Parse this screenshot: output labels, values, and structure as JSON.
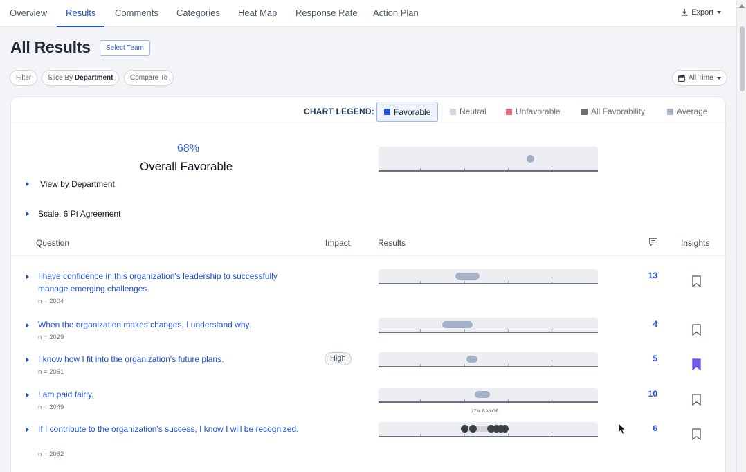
{
  "nav": {
    "tabs": [
      "Overview",
      "Results",
      "Comments",
      "Categories",
      "Heat Map",
      "Response Rate",
      "Action Plan"
    ],
    "active_tab": "Results",
    "export_label": "Export"
  },
  "header": {
    "title": "All Results",
    "select_team": "Select Team",
    "filter": "Filter",
    "slice_prefix": "Slice By",
    "slice_value": "Department",
    "compare": "Compare To",
    "time": "All Time"
  },
  "legend": {
    "title": "CHART LEGEND:",
    "items": [
      {
        "label": "Favorable",
        "color": "#1d4ed8",
        "active": true
      },
      {
        "label": "Neutral",
        "color": "#cfd6e2",
        "active": false
      },
      {
        "label": "Unfavorable",
        "color": "#e86a78",
        "active": false
      },
      {
        "label": "All Favorability",
        "color": "#6b6f76",
        "active": false
      },
      {
        "label": "Average",
        "color": "#a9b4c9",
        "active": false
      }
    ]
  },
  "overall": {
    "percent": "68%",
    "label": "Overall Favorable",
    "view_by": "View by Department",
    "scale": "Scale: 6 Pt Agreement",
    "marker_position": 0.69
  },
  "table": {
    "headers": {
      "question": "Question",
      "impact": "Impact",
      "results": "Results",
      "insights": "Insights"
    },
    "rows": [
      {
        "question": "I have confidence in this organization's leadership to successfully manage emerging challenges.",
        "n": "n = 2004",
        "impact": "",
        "count": "13",
        "bookmarked": false,
        "range_start": 0.35,
        "range_end": 0.46
      },
      {
        "question": "When the organization makes changes, I understand why.",
        "n": "n = 2029",
        "impact": "",
        "count": "4",
        "bookmarked": false,
        "range_start": 0.29,
        "range_end": 0.43
      },
      {
        "question": "I know how I fit into the organization's future plans.",
        "n": "n = 2051",
        "impact": "High",
        "count": "5",
        "bookmarked": true,
        "range_start": 0.4,
        "range_end": 0.45
      },
      {
        "question": "I am paid fairly.",
        "n": "n = 2049",
        "impact": "",
        "count": "10",
        "bookmarked": false,
        "range_start": 0.44,
        "range_end": 0.51
      },
      {
        "question": "If I contribute to the organization's success, I know I will be recognized.",
        "n": "n = 2062",
        "impact": "",
        "count": "6",
        "bookmarked": false,
        "range_label": "17% RANGE",
        "team_dots": [
          0.39,
          0.43,
          0.51,
          0.535,
          0.555,
          0.575
        ]
      }
    ]
  }
}
